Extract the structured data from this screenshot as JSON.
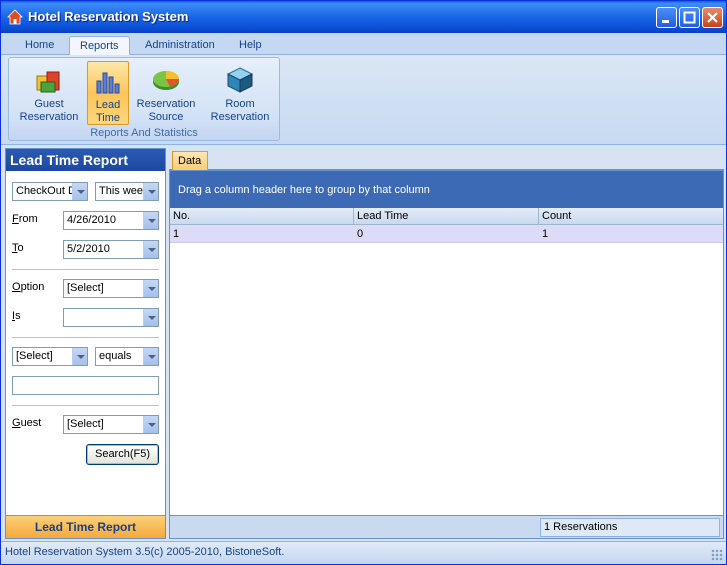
{
  "window": {
    "title": "Hotel Reservation System"
  },
  "tabs": [
    "Home",
    "Reports",
    "Administration",
    "Help"
  ],
  "ribbon": {
    "group_label": "Reports And Statistics",
    "buttons": [
      {
        "line1": "Guest",
        "line2": "Reservation",
        "icon": "guest-reservation-icon"
      },
      {
        "line1": "Lead",
        "line2": "Time",
        "icon": "lead-time-chart-icon"
      },
      {
        "line1": "Reservation",
        "line2": "Source",
        "icon": "pie-chart-icon"
      },
      {
        "line1": "Room",
        "line2": "Reservation",
        "icon": "room-cube-icon"
      }
    ]
  },
  "left_panel": {
    "title": "Lead Time Report",
    "date_field": "CheckOut D",
    "period": "This wee",
    "from_label_u": "F",
    "from_label_rest": "rom",
    "from_value": "4/26/2010",
    "to_label_u": "T",
    "to_label_rest": "o",
    "to_value": "5/2/2010",
    "option_label_u": "O",
    "option_label_rest": "ption",
    "option_value": "[Select]",
    "is_label_u": "I",
    "is_label_rest": "s",
    "is_value": "",
    "filter_field": "[Select]",
    "filter_op": "equals",
    "filter_text": "",
    "guest_label_u": "G",
    "guest_label_rest": "uest",
    "guest_value": "[Select]",
    "search_button": "Search(F5)",
    "footer": "Lead Time Report"
  },
  "grid": {
    "tab_label": "Data",
    "group_hint": "Drag a column header here to group by that column",
    "columns": [
      "No.",
      "Lead Time",
      "Count"
    ],
    "rows": [
      [
        "1",
        "0",
        "1"
      ]
    ],
    "summary": "1 Reservations"
  },
  "status": {
    "text": "Hotel Reservation System 3.5(c) 2005-2010, BistoneSoft."
  },
  "colors": {
    "title_bar": "#1d69e8",
    "panel_header": "#2c5ab3",
    "group_panel": "#3d6ab5",
    "accent_orange": "#f5a93a"
  }
}
